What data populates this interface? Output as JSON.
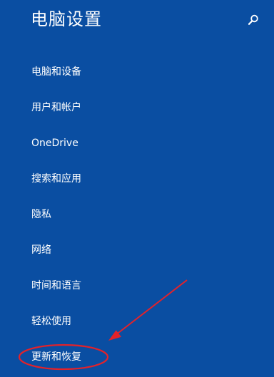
{
  "header": {
    "title": "电脑设置",
    "search_icon": "search-icon"
  },
  "nav": {
    "items": [
      {
        "label": "电脑和设备"
      },
      {
        "label": "用户和帐户"
      },
      {
        "label": "OneDrive"
      },
      {
        "label": "搜索和应用"
      },
      {
        "label": "隐私"
      },
      {
        "label": "网络"
      },
      {
        "label": "时间和语言"
      },
      {
        "label": "轻松使用"
      },
      {
        "label": "更新和恢复"
      }
    ],
    "highlighted": "更新和恢复"
  },
  "colors": {
    "background": "#0a4ea2",
    "text": "#ffffff",
    "annotation": "#e3222a"
  }
}
